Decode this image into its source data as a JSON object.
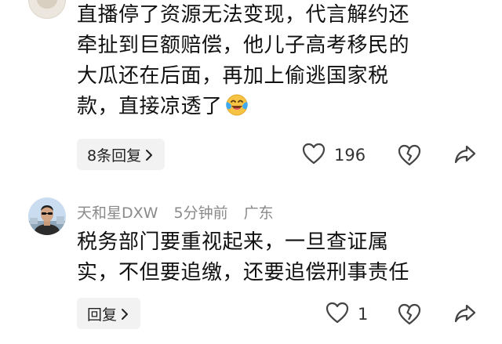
{
  "comments": [
    {
      "text_lines": [
        "直播停了资源无法变现，代言解约还",
        "牵扯到巨额赔偿，他儿子高考移民的",
        "大瓜还在后面，再加上偷逃国家税",
        "款，直接凉透了"
      ],
      "emoji": "laughing-crying-emoji",
      "reply_label": "8条回复",
      "like_count": "196",
      "icons": [
        "heart-icon",
        "broken-heart-icon",
        "share-icon",
        "chevron-right-icon"
      ]
    },
    {
      "username": "天和星DXW",
      "time": "5分钟前",
      "location": "广东",
      "text_lines": [
        "税务部门要重视起来，一旦查证属",
        "实，不但要追缴，还要追偿刑事责任"
      ],
      "reply_label": "回复",
      "like_count": "1",
      "icons": [
        "heart-icon",
        "broken-heart-icon",
        "share-icon",
        "chevron-right-icon"
      ]
    }
  ],
  "colors": {
    "text": "#111111",
    "meta": "#8a8a8a",
    "reply_bg": "#f2f2f2",
    "icon": "#444444",
    "background": "#ffffff"
  }
}
